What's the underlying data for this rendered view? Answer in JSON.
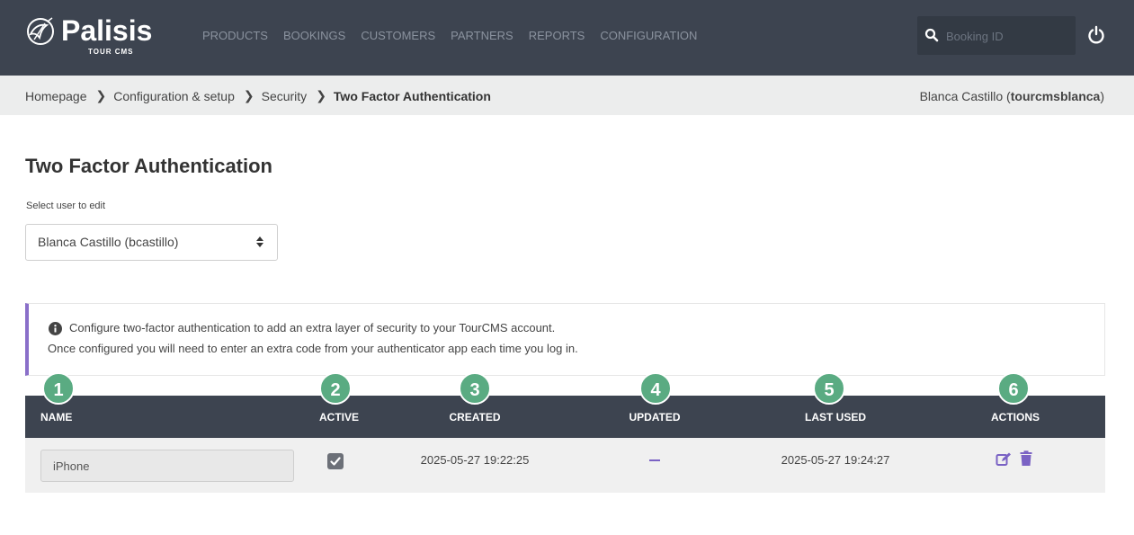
{
  "brand": {
    "name": "Palisis",
    "subtitle": "TOUR CMS"
  },
  "nav": {
    "items": [
      "PRODUCTS",
      "BOOKINGS",
      "CUSTOMERS",
      "PARTNERS",
      "REPORTS",
      "CONFIGURATION"
    ]
  },
  "search": {
    "placeholder": "Booking ID",
    "value": ""
  },
  "breadcrumb": {
    "items": [
      "Homepage",
      "Configuration & setup",
      "Security"
    ],
    "current": "Two Factor Authentication"
  },
  "user": {
    "name": "Blanca Castillo",
    "username": "tourcmsblanca"
  },
  "page": {
    "title": "Two Factor Authentication",
    "select_label": "Select user to edit",
    "selected_user": "Blanca Castillo (bcastillo)"
  },
  "info": {
    "line1": "Configure two-factor authentication to add an extra layer of security to your TourCMS account.",
    "line2": "Once configured you will need to enter an extra code from your authenticator app each time you log in."
  },
  "table": {
    "headers": {
      "name": "NAME",
      "active": "ACTIVE",
      "created": "CREATED",
      "updated": "UPDATED",
      "last_used": "LAST USED",
      "actions": "ACTIONS"
    },
    "rows": [
      {
        "name": "iPhone",
        "active": true,
        "created": "2025-05-27 19:22:25",
        "updated": "",
        "last_used": "2025-05-27 19:24:27"
      }
    ]
  },
  "badges": [
    "1",
    "2",
    "3",
    "4",
    "5",
    "6"
  ],
  "colors": {
    "topbar": "#3d4450",
    "badge": "#5aab82",
    "accent": "#8a6fc9",
    "action": "#7a62c4"
  }
}
